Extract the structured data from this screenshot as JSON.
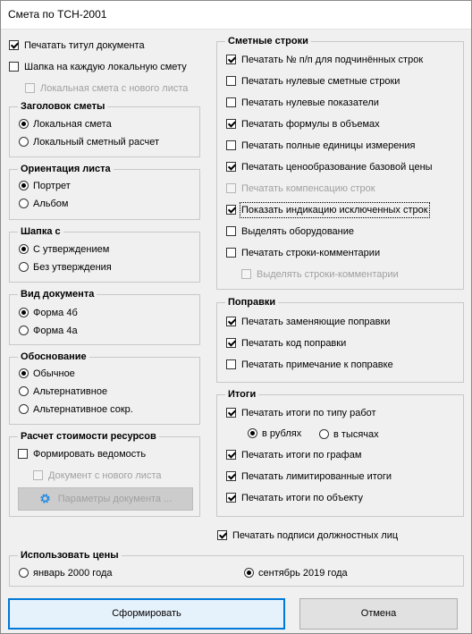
{
  "window": {
    "title": "Смета по ТСН-2001"
  },
  "top_options": {
    "print_title": {
      "label": "Печатать титул документа",
      "checked": true
    },
    "header_each": {
      "label": "Шапка на каждую локальную смету",
      "checked": false
    },
    "local_new_sheet": {
      "label": "Локальная смета с нового листа",
      "checked": false,
      "disabled": true
    }
  },
  "estimate_header": {
    "title": "Заголовок сметы",
    "options": [
      "Локальная смета",
      "Локальный сметный расчет"
    ],
    "selected": 0
  },
  "orientation": {
    "title": "Ориентация листа",
    "options": [
      "Портрет",
      "Альбом"
    ],
    "selected": 0
  },
  "header_with": {
    "title": "Шапка с",
    "options": [
      "С утверждением",
      "Без утверждения"
    ],
    "selected": 0
  },
  "doc_type": {
    "title": "Вид документа",
    "options": [
      "Форма 4б",
      "Форма 4а"
    ],
    "selected": 0
  },
  "justification": {
    "title": "Обоснование",
    "options": [
      "Обычное",
      "Альтернативное",
      "Альтернативное сокр."
    ],
    "selected": 0
  },
  "resources": {
    "title": "Расчет стоимости ресурсов",
    "form_statement": {
      "label": "Формировать ведомость",
      "checked": false
    },
    "doc_new_sheet": {
      "label": "Документ с нового листа",
      "checked": false,
      "disabled": true
    },
    "params_button": "Параметры документа ..."
  },
  "estimate_rows": {
    "title": "Сметные строки",
    "items": [
      {
        "label": "Печатать № п/п для подчинённых строк",
        "checked": true
      },
      {
        "label": "Печатать нулевые сметные строки",
        "checked": false
      },
      {
        "label": "Печатать нулевые показатели",
        "checked": false
      },
      {
        "label": "Печатать формулы в объемах",
        "checked": true
      },
      {
        "label": "Печатать полные единицы измерения",
        "checked": false
      },
      {
        "label": "Печатать ценообразование базовой цены",
        "checked": true
      },
      {
        "label": "Печатать компенсацию строк",
        "checked": false,
        "disabled": true
      },
      {
        "label": "Показать индикацию исключенных строк",
        "checked": true
      },
      {
        "label": "Выделять оборудование",
        "checked": false
      },
      {
        "label": "Печатать строки-комментарии",
        "checked": false
      },
      {
        "label": "Выделять строки-комментарии",
        "checked": false,
        "disabled": true
      }
    ]
  },
  "corrections": {
    "title": "Поправки",
    "items": [
      {
        "label": "Печатать заменяющие поправки",
        "checked": true
      },
      {
        "label": "Печатать код поправки",
        "checked": true
      },
      {
        "label": "Печатать примечание к поправке",
        "checked": false
      }
    ]
  },
  "totals": {
    "title": "Итоги",
    "by_work_type": {
      "label": "Печатать итоги по типу работ",
      "checked": true
    },
    "units": {
      "options": [
        "в рублях",
        "в тысячах"
      ],
      "selected": 0
    },
    "by_columns": {
      "label": "Печатать итоги по графам",
      "checked": true
    },
    "limited": {
      "label": "Печатать лимитированные итоги",
      "checked": true
    },
    "by_object": {
      "label": "Печатать итоги по объекту",
      "checked": true
    }
  },
  "signatures": {
    "label": "Печатать подписи должностных лиц",
    "checked": true
  },
  "prices": {
    "title": "Использовать цены",
    "options": [
      "январь 2000 года",
      "сентябрь 2019 года"
    ],
    "selected": 1
  },
  "buttons": {
    "generate": "Сформировать",
    "cancel": "Отмена"
  },
  "colors": {
    "accent": "#0078d7",
    "disabled_text": "#a0a0a0",
    "background": "#f0f0f0"
  }
}
